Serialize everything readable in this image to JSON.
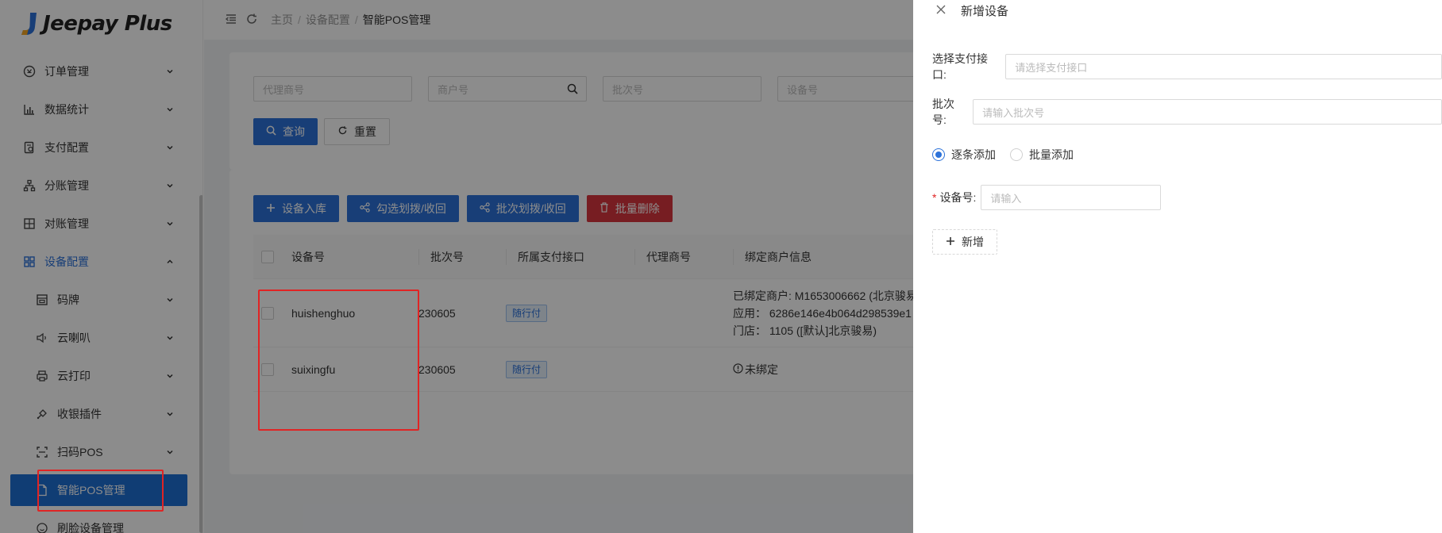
{
  "app": {
    "name": "Jeepay Plus",
    "colors": {
      "primary": "#2d72d9",
      "danger": "#d9363e",
      "highlight": "#e02424"
    }
  },
  "sidebar": {
    "items": [
      {
        "label": "订单管理",
        "icon": "order-icon"
      },
      {
        "label": "数据统计",
        "icon": "chart-icon"
      },
      {
        "label": "支付配置",
        "icon": "payment-config-icon"
      },
      {
        "label": "分账管理",
        "icon": "split-icon"
      },
      {
        "label": "对账管理",
        "icon": "reconcile-icon"
      },
      {
        "label": "设备配置",
        "icon": "grid-icon"
      }
    ],
    "sub_items": [
      {
        "label": "码牌",
        "icon": "qrcode-card-icon"
      },
      {
        "label": "云喇叭",
        "icon": "speaker-icon"
      },
      {
        "label": "云打印",
        "icon": "printer-icon"
      },
      {
        "label": "收银插件",
        "icon": "plugin-icon"
      },
      {
        "label": "扫码POS",
        "icon": "scan-icon"
      }
    ],
    "active": {
      "label": "智能POS管理",
      "icon": "document-icon"
    },
    "after_active": {
      "label": "刷脸设备管理",
      "icon": "face-icon"
    }
  },
  "breadcrumb": {
    "home": "主页",
    "parent": "设备配置",
    "current": "智能POS管理"
  },
  "filters": {
    "agent_placeholder": "代理商号",
    "merchant_placeholder": "商户号",
    "batch_placeholder": "批次号",
    "device_placeholder": "设备号",
    "query_label": "查询",
    "reset_label": "重置"
  },
  "actions": {
    "stock_in": "设备入库",
    "select_assign": "勾选划拨/收回",
    "batch_assign": "批次划拨/收回",
    "batch_delete": "批量删除"
  },
  "table": {
    "headers": {
      "device": "设备号",
      "batch": "批次号",
      "interface": "所属支付接口",
      "agent": "代理商号",
      "bind": "绑定商户信息"
    },
    "rows": [
      {
        "device": "huishenghuo",
        "batch": "230605",
        "interface": "随行付",
        "bind_line1": "已绑定商户: M1653006662 (北京骏易",
        "bind_line2": "应用：  6286e146e4b064d298539e1",
        "bind_line3": "门店：  1105 ([默认]北京骏易)"
      },
      {
        "device": "suixingfu",
        "batch": "230605",
        "interface": "随行付",
        "bind_unbound": "未绑定"
      }
    ]
  },
  "drawer": {
    "title": "新增设备",
    "interface_label": "选择支付接口:",
    "interface_placeholder": "请选择支付接口",
    "batch_label": "批次号:",
    "batch_placeholder": "请输入批次号",
    "mode_single": "逐条添加",
    "mode_batch": "批量添加",
    "device_label": "设备号:",
    "device_placeholder": "请输入",
    "add_label": "新增"
  }
}
